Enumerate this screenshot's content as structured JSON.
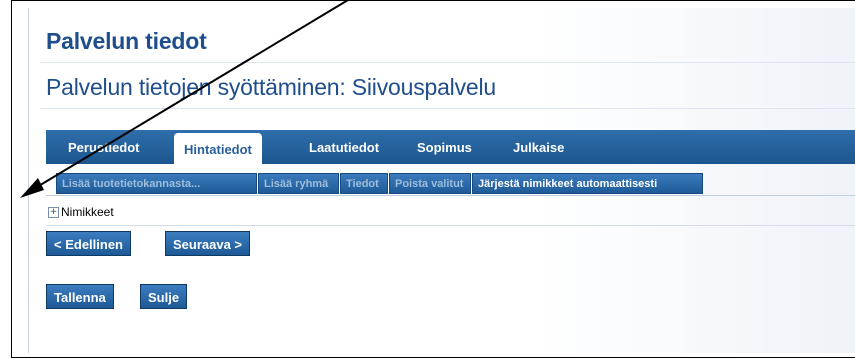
{
  "page": {
    "title": "Palvelun tiedot",
    "subtitle": "Palvelun tietojen syöttäminen: Siivouspalvelu"
  },
  "tabs": [
    {
      "label": "Perustiedot",
      "active": false
    },
    {
      "label": "Hintatiedot",
      "active": true
    },
    {
      "label": "Laatutiedot",
      "active": false
    },
    {
      "label": "Sopimus",
      "active": false
    },
    {
      "label": "Julkaise",
      "active": false
    }
  ],
  "toolbar": [
    {
      "label": "Lisää tuotetietokannasta...",
      "enabled": false
    },
    {
      "label": "Lisää ryhmä",
      "enabled": false
    },
    {
      "label": "Tiedot",
      "enabled": false
    },
    {
      "label": "Poista valitut",
      "enabled": false
    },
    {
      "label": "Järjestä nimikkeet automaattisesti",
      "enabled": true
    }
  ],
  "tree": {
    "expand_symbol": "+",
    "root_label": "Nimikkeet"
  },
  "navigation": {
    "previous_label": "< Edellinen",
    "next_label": "Seuraava >"
  },
  "actions": {
    "save_label": "Tallenna",
    "close_label": "Sulje"
  },
  "colors": {
    "title": "#1f4e8c",
    "tabbar": "#2462a0",
    "button": "#2a6aad"
  },
  "icons": {
    "annotation": "arrow-icon",
    "expand": "plus-box-icon"
  }
}
